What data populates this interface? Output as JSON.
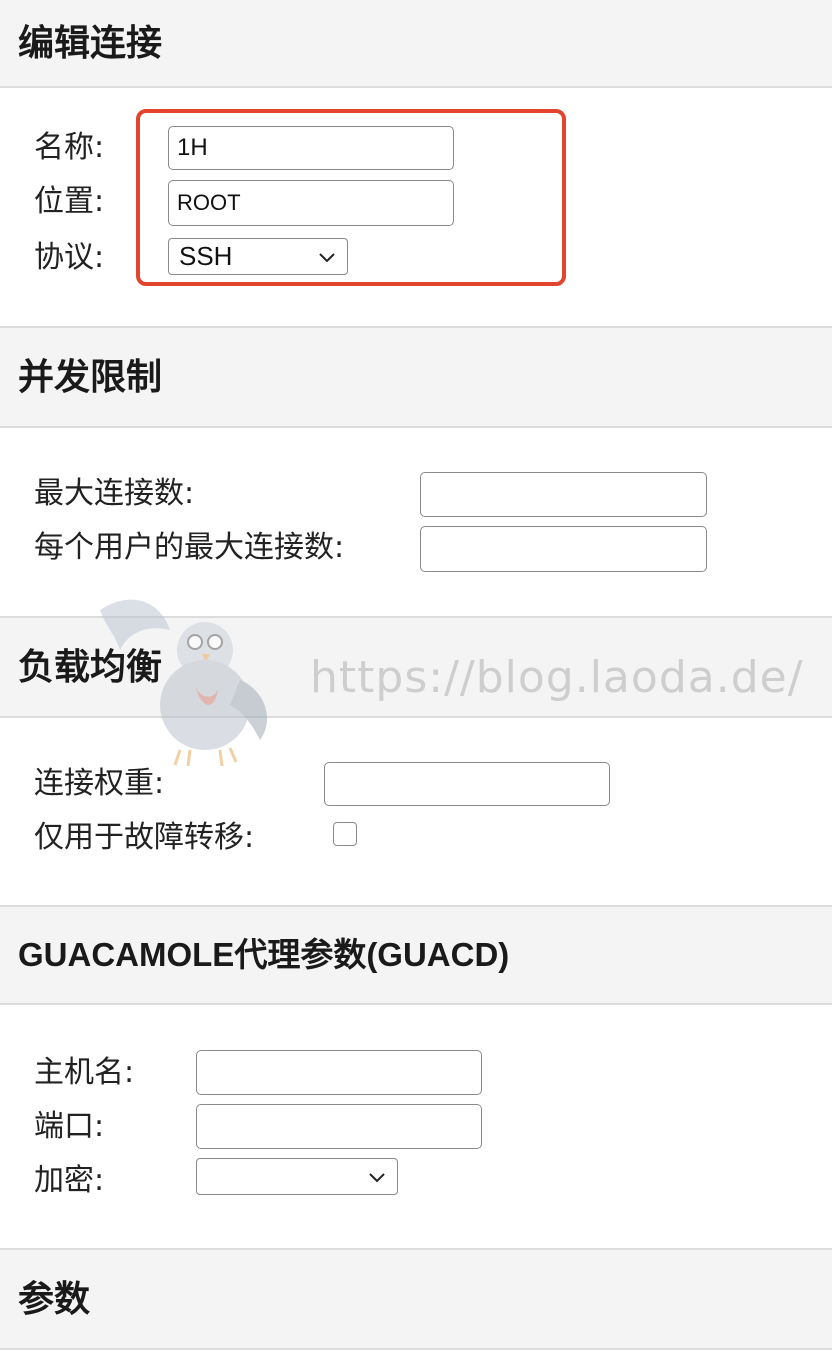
{
  "sections": {
    "edit_connection": {
      "title": "编辑连接"
    },
    "concurrency": {
      "title": "并发限制"
    },
    "load_balancing": {
      "title": "负载均衡"
    },
    "guacd": {
      "title": "GUACAMOLE代理参数(GUACD)"
    },
    "parameters": {
      "title": "参数"
    }
  },
  "edit_connection": {
    "name_label": "名称:",
    "name_value": "1H",
    "location_label": "位置:",
    "location_value": "ROOT",
    "protocol_label": "协议:",
    "protocol_value": "SSH"
  },
  "concurrency": {
    "max_connections_label": "最大连接数:",
    "max_connections_value": "",
    "max_per_user_label": "每个用户的最大连接数:",
    "max_per_user_value": ""
  },
  "load_balancing": {
    "weight_label": "连接权重:",
    "weight_value": "",
    "failover_only_label": "仅用于故障转移:",
    "failover_only_checked": false
  },
  "guacd": {
    "hostname_label": "主机名:",
    "hostname_value": "",
    "port_label": "端口:",
    "port_value": "",
    "encryption_label": "加密:",
    "encryption_value": ""
  },
  "watermark": {
    "text": "https://blog.laoda.de/"
  },
  "colors": {
    "highlight": "#e2452c",
    "header_bg": "#f4f4f4",
    "border": "#dcdcdc"
  },
  "icons": [
    "chevron-down-icon",
    "pigeon-mascot-icon"
  ]
}
